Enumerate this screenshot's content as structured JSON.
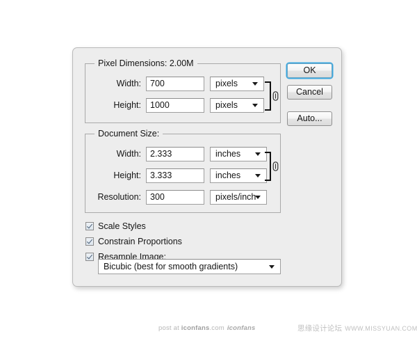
{
  "dialog": {
    "name": "Image Size",
    "background_color": "#ededed"
  },
  "pixel_dimensions": {
    "title": "Pixel Dimensions:  2.00M",
    "size_label": "2.00M",
    "rows": [
      {
        "label": "Width:",
        "value": "700",
        "unit": "pixels"
      },
      {
        "label": "Height:",
        "value": "1000",
        "unit": "pixels"
      }
    ],
    "link_icon": "chain-link-icon"
  },
  "document_size": {
    "title": "Document Size:",
    "rows": [
      {
        "label": "Width:",
        "value": "2.333",
        "unit": "inches"
      },
      {
        "label": "Height:",
        "value": "3.333",
        "unit": "inches"
      },
      {
        "label": "Resolution:",
        "value": "300",
        "unit": "pixels/inch"
      }
    ],
    "link_icon": "chain-link-icon"
  },
  "options": {
    "checkboxes": [
      {
        "label": "Scale Styles",
        "checked": true
      },
      {
        "label": "Constrain Proportions",
        "checked": true
      },
      {
        "label": "Resample Image:",
        "checked": true
      }
    ],
    "resample_method": "Bicubic (best for smooth gradients)"
  },
  "buttons": {
    "ok": "OK",
    "cancel": "Cancel",
    "auto": "Auto...",
    "default_accent_color": "#3ba7df"
  },
  "watermarks": {
    "left_prefix": "post at ",
    "left_brand": "iconfans",
    "left_suffix": ".com",
    "left_logo": "iconfans",
    "right_text": "思缘设计论坛",
    "right_url": "WWW.MISSYUAN.COM"
  }
}
